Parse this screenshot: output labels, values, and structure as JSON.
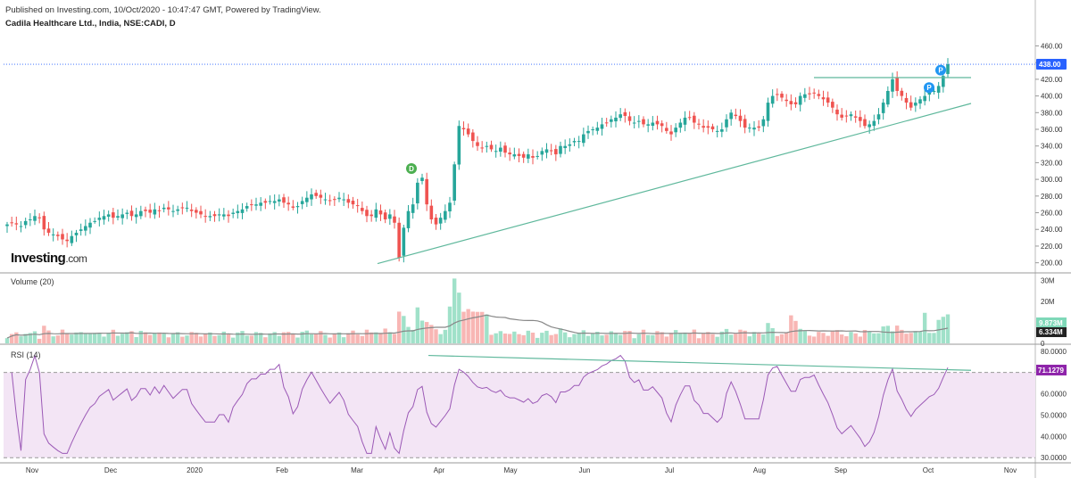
{
  "header": {
    "published": "Published on Investing.com, 10/Oct/2020 - 10:47:47 GMT, Powered by TradingView.",
    "symbol": "Cadila Healthcare Ltd., India, NSE:CADI, D"
  },
  "watermark": {
    "brand": "Investing",
    "suffix": ".com"
  },
  "colors": {
    "up": "#26a69a",
    "up_fill": "#26a69a",
    "down": "#ef5350",
    "trendline": "#5fb89c",
    "rsi_line": "#9b59b6",
    "rsi_bg": "#f3e5f5",
    "price_tag": "#2962ff",
    "rsi_tag": "#8e24aa"
  },
  "chart_data": [
    {
      "type": "candlestick",
      "title": "Cadila Healthcare Ltd., India, NSE:CADI, D",
      "y_ticks": [
        "460.00",
        "440.00",
        "420.00",
        "400.00",
        "380.00",
        "360.00",
        "340.00",
        "320.00",
        "300.00",
        "280.00",
        "260.00",
        "240.00",
        "220.00",
        "200.00"
      ],
      "ylim": [
        190,
        468
      ],
      "last_price_label": "438.00",
      "last_price": 438,
      "x_ticks": [
        "Nov",
        "Dec",
        "2020",
        "Feb",
        "Mar",
        "Apr",
        "May",
        "Jun",
        "Jul",
        "Aug",
        "Sep",
        "Oct",
        "Nov"
      ],
      "marker_labels": [
        "D",
        "P",
        "P"
      ],
      "closes": [
        246,
        248,
        246,
        244,
        250,
        252,
        256,
        254,
        240,
        236,
        234,
        232,
        228,
        226,
        232,
        236,
        240,
        244,
        248,
        250,
        254,
        256,
        258,
        254,
        256,
        258,
        260,
        256,
        258,
        262,
        262,
        260,
        264,
        262,
        266,
        264,
        262,
        264,
        266,
        266,
        262,
        260,
        258,
        256,
        256,
        256,
        258,
        258,
        256,
        260,
        262,
        264,
        268,
        270,
        270,
        272,
        272,
        274,
        274,
        276,
        272,
        270,
        266,
        268,
        274,
        278,
        282,
        280,
        278,
        276,
        274,
        276,
        278,
        276,
        272,
        270,
        268,
        262,
        256,
        256,
        264,
        258,
        252,
        258,
        248,
        206,
        242,
        262,
        270,
        296,
        302,
        270,
        252,
        246,
        254,
        262,
        272,
        318,
        364,
        360,
        354,
        346,
        340,
        338,
        340,
        336,
        334,
        338,
        332,
        330,
        330,
        328,
        326,
        330,
        326,
        328,
        334,
        336,
        334,
        330,
        340,
        340,
        342,
        346,
        346,
        354,
        358,
        360,
        362,
        366,
        368,
        372,
        374,
        378,
        376,
        370,
        368,
        370,
        366,
        366,
        368,
        366,
        364,
        358,
        354,
        362,
        368,
        374,
        374,
        368,
        366,
        362,
        362,
        360,
        358,
        360,
        372,
        380,
        376,
        370,
        362,
        362,
        362,
        362,
        372,
        392,
        400,
        402,
        398,
        394,
        390,
        390,
        400,
        402,
        402,
        404,
        400,
        396,
        392,
        386,
        378,
        374,
        376,
        378,
        374,
        370,
        364,
        366,
        370,
        378,
        392,
        406,
        420,
        406,
        400,
        392,
        386,
        392,
        396,
        400,
        404,
        406,
        412,
        424,
        438
      ],
      "volume_y_ticks": [
        "30M",
        "20M",
        "10M",
        "0"
      ],
      "volume_last_labels": [
        "9.873M",
        "6.334M"
      ],
      "rsi_title": "RSI (14)",
      "rsi_y_ticks": [
        "80.0000",
        "70.0000",
        "60.0000",
        "50.0000",
        "40.0000",
        "30.0000"
      ],
      "rsi_last_label": "71.1279",
      "rsi_ylim": [
        28,
        82
      ]
    }
  ],
  "panes": {
    "volume_title": "Volume (20)",
    "rsi_title": "RSI (14)"
  }
}
